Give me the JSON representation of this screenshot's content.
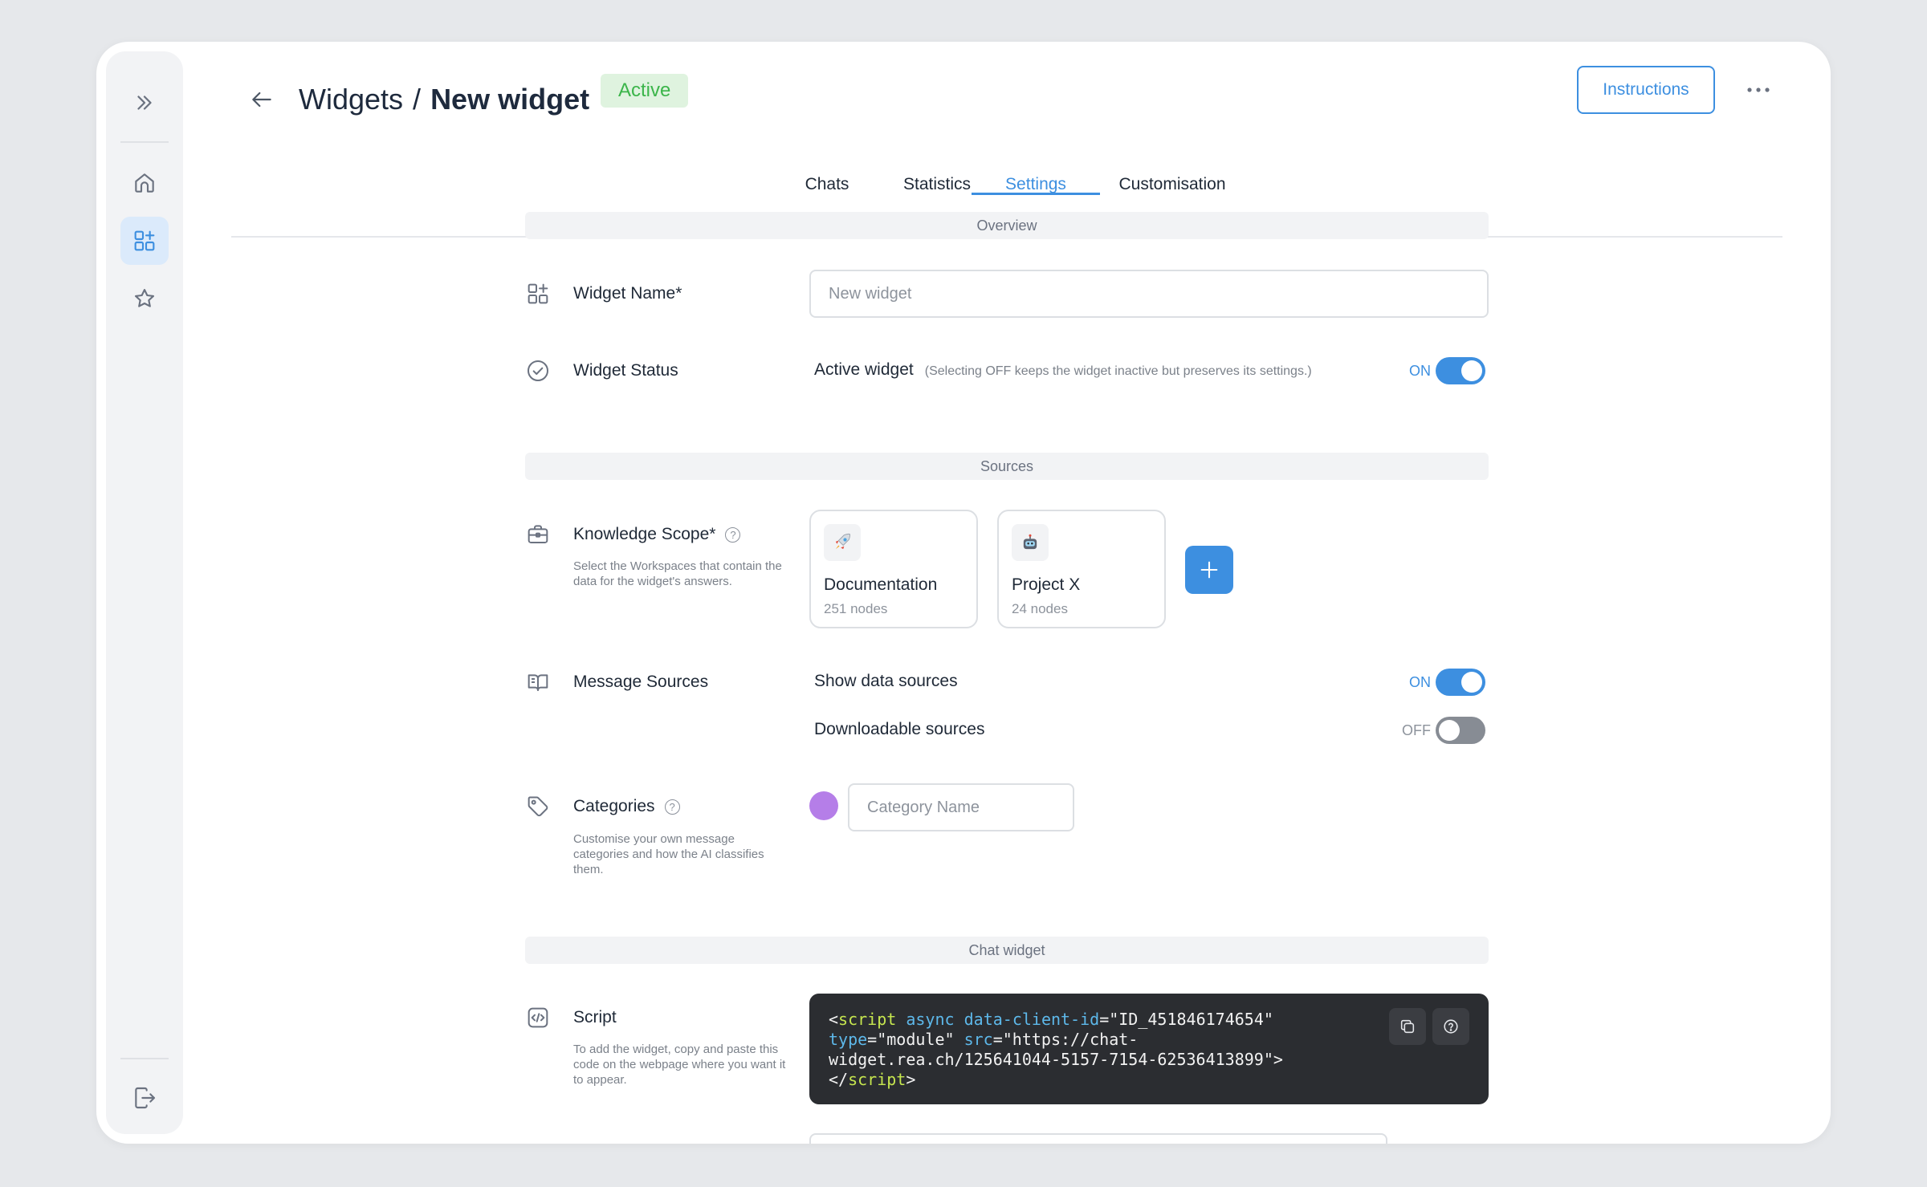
{
  "header": {
    "breadcrumb_parent": "Widgets",
    "breadcrumb_separator": "/",
    "title": "New widget",
    "status_badge": "Active",
    "instructions_label": "Instructions"
  },
  "sidebar": {
    "items": [
      {
        "name": "expand",
        "icon": "double-chevron-right-icon"
      },
      {
        "name": "home",
        "icon": "home-icon"
      },
      {
        "name": "widgets",
        "icon": "widgets-grid-icon",
        "active": true
      },
      {
        "name": "favorites",
        "icon": "star-icon"
      },
      {
        "name": "logout",
        "icon": "logout-icon"
      }
    ]
  },
  "tabs": [
    {
      "label": "Chats",
      "active": false
    },
    {
      "label": "Statistics",
      "active": false
    },
    {
      "label": "Settings",
      "active": true
    },
    {
      "label": "Customisation",
      "active": false
    }
  ],
  "sections": {
    "overview": "Overview",
    "sources": "Sources",
    "chat_widget": "Chat widget"
  },
  "widget_name": {
    "label": "Widget Name*",
    "placeholder": "New widget"
  },
  "widget_status": {
    "label": "Widget Status",
    "field_label": "Active widget",
    "hint": "(Selecting OFF keeps the widget inactive but preserves its settings.)",
    "toggle_text": "ON",
    "on": true
  },
  "knowledge_scope": {
    "label": "Knowledge Scope*",
    "description": "Select the Workspaces that contain the data for the widget's answers.",
    "workspaces": [
      {
        "name": "Documentation",
        "count": "251 nodes",
        "icon": "rocket-icon"
      },
      {
        "name": "Project X",
        "count": "24 nodes",
        "icon": "robot-icon"
      }
    ]
  },
  "message_sources": {
    "label": "Message Sources",
    "show_data_sources": {
      "label": "Show data sources",
      "toggle_text": "ON",
      "on": true
    },
    "downloadable_sources": {
      "label": "Downloadable sources",
      "toggle_text": "OFF",
      "on": false
    }
  },
  "categories": {
    "label": "Categories",
    "description": "Customise your own message categories and how the AI classifies them.",
    "placeholder": "Category Name",
    "color": "#b57ee8"
  },
  "script": {
    "label": "Script",
    "description": "To add the widget, copy and paste this code on the webpage where you want it to appear.",
    "code_lines": [
      [
        {
          "t": "<",
          "c": ""
        },
        {
          "t": "script",
          "c": "tag"
        },
        {
          "t": " ",
          "c": ""
        },
        {
          "t": "async",
          "c": "attr"
        },
        {
          "t": " ",
          "c": ""
        },
        {
          "t": "data-client-id",
          "c": "attr"
        },
        {
          "t": "=\"ID_451846174654\"",
          "c": ""
        }
      ],
      [
        {
          "t": "type",
          "c": "attr"
        },
        {
          "t": "=\"module\" ",
          "c": ""
        },
        {
          "t": "src",
          "c": "attr"
        },
        {
          "t": "=\"https://chat-",
          "c": ""
        }
      ],
      [
        {
          "t": "widget.rea.ch/125641044-5157-7154-62536413899\">",
          "c": ""
        }
      ],
      [
        {
          "t": "</",
          "c": ""
        },
        {
          "t": "script",
          "c": "tag"
        },
        {
          "t": ">",
          "c": ""
        }
      ]
    ]
  },
  "colors": {
    "accent": "#3d8fe0",
    "active_badge_bg": "#dff3df",
    "active_badge_text": "#3bb54a",
    "code_bg": "#2b2d31"
  }
}
